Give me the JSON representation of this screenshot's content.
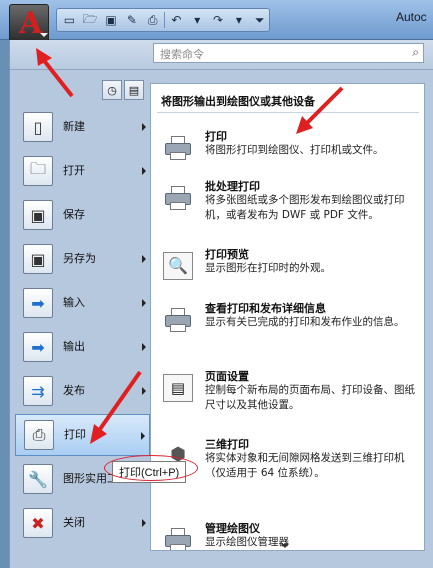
{
  "app": {
    "title_partial": "Autoc",
    "logo_letter": "A"
  },
  "qat": {
    "icons": [
      "new-icon",
      "open-icon",
      "save-icon",
      "save-as-icon",
      "print-icon",
      "undo-icon",
      "redo-icon",
      "customize-icon"
    ]
  },
  "search": {
    "placeholder": "搜索命令"
  },
  "left_menu": [
    {
      "label": "新建",
      "has_arrow": true
    },
    {
      "label": "打开",
      "has_arrow": true
    },
    {
      "label": "保存",
      "has_arrow": false
    },
    {
      "label": "另存为",
      "has_arrow": true
    },
    {
      "label": "输入",
      "has_arrow": true
    },
    {
      "label": "输出",
      "has_arrow": true
    },
    {
      "label": "发布",
      "has_arrow": true
    },
    {
      "label": "打印",
      "has_arrow": true,
      "active": true
    },
    {
      "label": "图形实用工具",
      "has_arrow": false
    },
    {
      "label": "关闭",
      "has_arrow": true
    }
  ],
  "right_panel": {
    "title": "将图形输出到绘图仪或其他设备",
    "entries": [
      {
        "title": "打印",
        "desc": "将图形打印到绘图仪、打印机或文件。"
      },
      {
        "title": "批处理打印",
        "desc": "将多张图纸或多个图形发布到绘图仪或打印机，或者发布为 DWF 或 PDF 文件。"
      },
      {
        "title": "打印预览",
        "desc": "显示图形在打印时的外观。"
      },
      {
        "title": "查看打印和发布详细信息",
        "desc": "显示有关已完成的打印和发布作业的信息。"
      },
      {
        "title": "页面设置",
        "desc": "控制每个新布局的页面布局、打印设备、图纸尺寸以及其他设置。"
      },
      {
        "title": "三维打印",
        "desc": "将实体对象和无间隙网格发送到三维打印机（仅适用于 64 位系统）。"
      },
      {
        "title": "管理绘图仪",
        "desc": "显示绘图仪管理器"
      }
    ]
  },
  "tooltip": {
    "text": "打印(Ctrl+P)"
  },
  "colors": {
    "annotation": "#e02020",
    "active_item": "#a9cdf2"
  }
}
